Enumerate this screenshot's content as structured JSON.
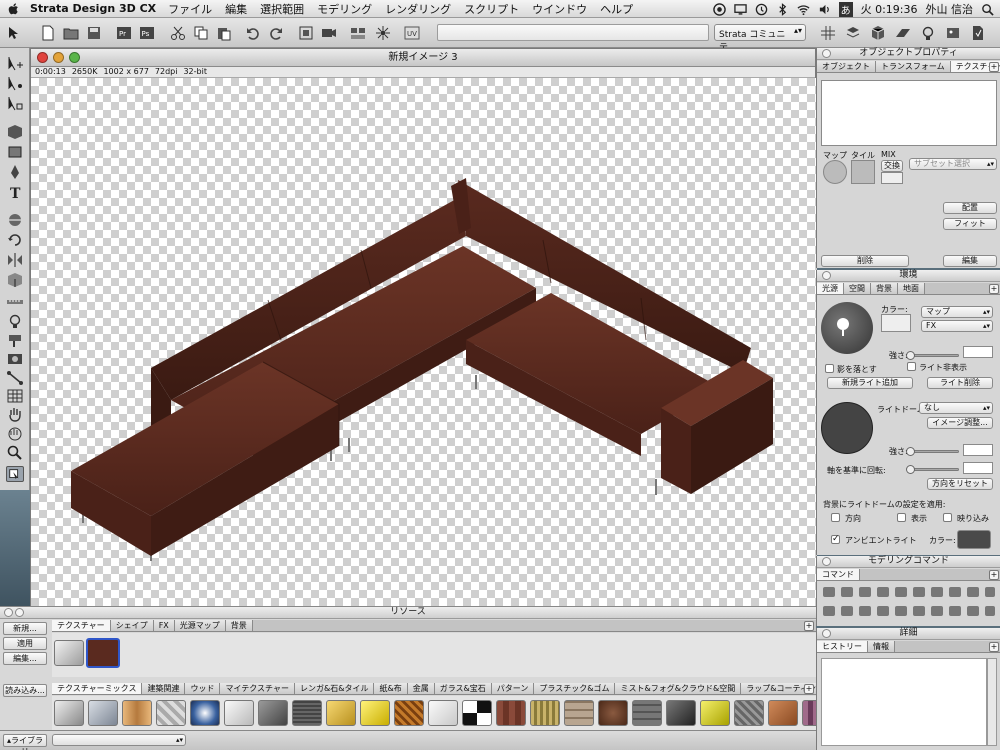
{
  "menubar": {
    "app_name": "Strata Design 3D CX",
    "items": [
      "ファイル",
      "編集",
      "選択範囲",
      "モデリング",
      "レンダリング",
      "スクリプト",
      "ウインドウ",
      "ヘルプ"
    ],
    "input_indicator": "あ",
    "clock": "火 0:19:36",
    "user": "外山 信治"
  },
  "toolbar": {
    "community_select": "Strata コミュニテ..."
  },
  "document": {
    "title": "新規イメージ 3",
    "info": [
      "0:00:13",
      "2650K",
      "1002 x 677",
      "72dpi",
      "32-bit"
    ]
  },
  "resources": {
    "title": "リソース",
    "left_buttons": [
      "新規...",
      "適用",
      "編集...",
      "読み込み..."
    ],
    "tabs": [
      "テクスチャー",
      "シェイプ",
      "FX",
      "光源マップ",
      "背景"
    ],
    "library_tabs": [
      "テクスチャーミックス",
      "建築関連",
      "ウッド",
      "マイテクスチャー",
      "レンガ&石&タイル",
      "紙&布",
      "金属",
      "ガラス&宝石",
      "パターン",
      "プラスチック&ゴム",
      "ミスト&フォグ&クラウド&空間",
      "ラップ&コーティング"
    ],
    "library_button": "ライブラリ"
  },
  "object_properties": {
    "title": "オブジェクトプロパティ",
    "tabs": [
      "オブジェクト",
      "トランスフォーム",
      "テクスチャー"
    ],
    "map_labels": [
      "マップ",
      "タイル",
      "MIX"
    ],
    "swap_label": "交換",
    "subset_select": "サブセット選択",
    "buttons": [
      "配置",
      "フィット",
      "削除",
      "編集"
    ]
  },
  "environment": {
    "title": "環境",
    "tabs": [
      "光源",
      "空間",
      "背景",
      "地面"
    ],
    "color_label": "カラー:",
    "map_select": "マップ",
    "fx_select": "FX",
    "strength_label": "強さ:",
    "cast_shadow": "影を落とす",
    "light_hide": "ライト非表示",
    "add_light": "新規ライト追加",
    "delete_light": "ライト削除",
    "light_dome_label": "ライトドーム:",
    "light_dome_value": "なし",
    "image_adjust": "イメージ調整...",
    "strength2_label": "強さ:",
    "rotate_label": "軸を基準に回転:",
    "reset_direction": "方向をリセット",
    "apply_label": "背景にライトドームの設定を適用:",
    "apply_opts": [
      "方向",
      "表示",
      "映り込み"
    ],
    "ambient_label": "アンビエントライト",
    "ambient_color_label": "カラー:"
  },
  "modeling": {
    "title": "モデリングコマンド",
    "tab": "コマンド"
  },
  "details": {
    "title": "詳細",
    "tabs": [
      "ヒストリー",
      "情報"
    ]
  },
  "colors": {
    "sofa": "#5a2a1f",
    "selection": "#2f56c9"
  }
}
